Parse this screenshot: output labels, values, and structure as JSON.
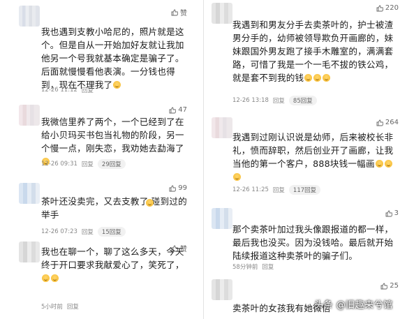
{
  "left": [
    {
      "likes": "赞",
      "text": "我也遇到支教小哈尼的，照片就是这个。但是自从一开始加好友就让我加他另一个号我就基本确定是骗子了。后面就慢慢看他表演。一分钱也得到，现在不理我了",
      "emoji_count": 1,
      "time": "12-26 11:12",
      "reply": "回复",
      "reply_count": ""
    },
    {
      "likes": "47",
      "text": "我微信里养了两个，一个已经到了在给小贝玛买书包当礼物的阶段，另一个慢一点，刚失恋，我劝她去勐海了",
      "emoji_count": 1,
      "time": "12-26 09:31",
      "reply": "回复",
      "reply_count": "29回复"
    },
    {
      "likes": "99",
      "text": "茶叶还没卖完，又去支教了 碰到过的举手",
      "emoji_count": 1,
      "time": "12-26 07:23",
      "reply": "回复",
      "reply_count": "15回复"
    },
    {
      "likes": "赞",
      "text": "我也在聊一个，聊了这么多天，今天终于开口要求我献爱心了，笑死了，",
      "emoji_count": 2,
      "time": "5小时前",
      "reply": "回复",
      "reply_count": ""
    }
  ],
  "right": [
    {
      "likes": "220",
      "text": "我遇到和男友分手去卖茶叶的，护士被渣男分手的，幼师被领导欺负开画廊的，妹妹跟国外男友跑了接手木雕室的，满满套路，可惜了我是一个一毛不拔的铁公鸡，就是套不到我的钱",
      "emoji_count": 3,
      "time": "12-26 13:18",
      "reply": "回复",
      "reply_count": "85回复"
    },
    {
      "likes": "264",
      "text": "我遇到过刚认识说是幼师，后来被校长非礼，愤而辞职，然后创业开了画廊，让我当他的第一个客户，888块钱一幅画",
      "emoji_count": 3,
      "time": "12-26 11:25",
      "reply": "回复",
      "reply_count": "117回复"
    },
    {
      "likes": "3",
      "text": "那个卖茶叶加过我头像跟报道的都一样，最后我也没买。因为没钱哈。最后就开始陆续报道这种卖茶叶的骗子们。",
      "emoji_count": 0,
      "time": "58分钟前",
      "reply": "回复",
      "reply_count": ""
    },
    {
      "likes": "25",
      "text": "卖茶叶的女孩我有她微信",
      "emoji_count": 0,
      "time": "",
      "reply": "",
      "reply_count": ""
    }
  ],
  "watermark": "头条 @旧趣来兮馆",
  "icons": {
    "thumb": "thumbs-up-icon",
    "emoji": "laughing-emoji-icon",
    "avatar": "blurred-avatar"
  }
}
